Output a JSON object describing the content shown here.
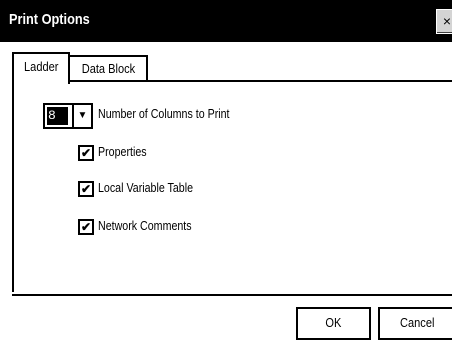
{
  "window": {
    "title": "Print Options",
    "close_label": "×"
  },
  "tabs": [
    {
      "label": "Ladder",
      "active": true
    },
    {
      "label": "Data Block",
      "active": false
    }
  ],
  "columns": {
    "value": "8",
    "label": "Number of Columns to Print"
  },
  "options": [
    {
      "label": "Properties",
      "checked": true,
      "mark": "✔"
    },
    {
      "label": "Local Variable Table",
      "checked": true,
      "mark": "✔"
    },
    {
      "label": "Network Comments",
      "checked": true,
      "mark": "✔"
    }
  ],
  "buttons": {
    "ok": "OK",
    "cancel": "Cancel"
  },
  "icons": {
    "dropdown": "chevron-down-icon",
    "close": "close-icon"
  },
  "colors": {
    "titlebar": "#000000",
    "background": "#ffffff"
  }
}
